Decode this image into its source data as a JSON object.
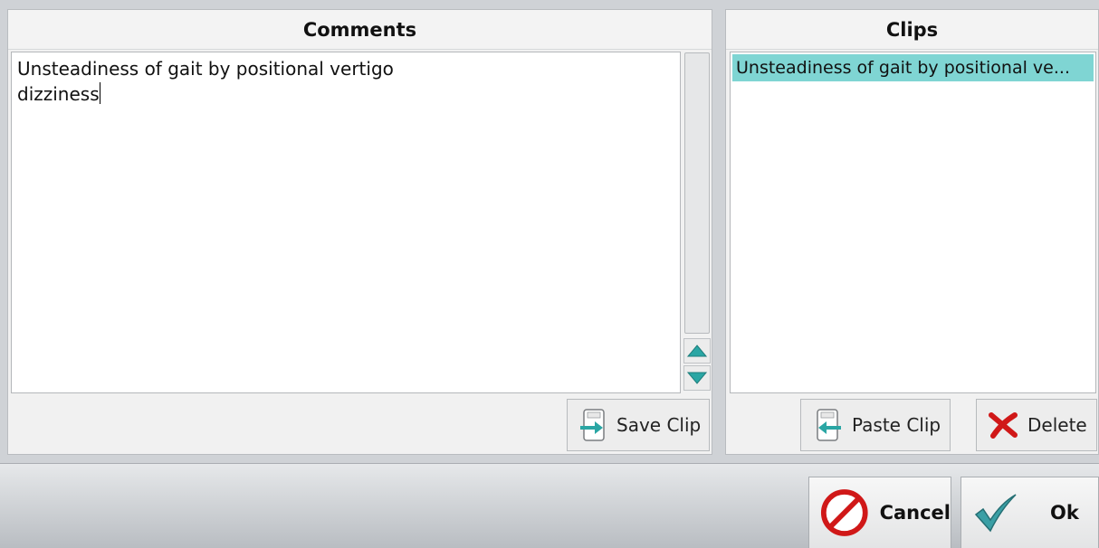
{
  "comments": {
    "title": "Comments",
    "lines": [
      "Unsteadiness of gait by positional vertigo",
      "dizziness"
    ],
    "save_clip_label": "Save Clip"
  },
  "clips": {
    "title": "Clips",
    "items": [
      "Unsteadiness of gait by positional ve..."
    ],
    "paste_clip_label": "Paste Clip",
    "delete_label": "Delete"
  },
  "footer": {
    "cancel_label": "Cancel",
    "ok_label": "Ok"
  },
  "colors": {
    "selection": "#7fd5d3",
    "arrow_teal": "#2aa6a4",
    "cancel_red": "#d01818",
    "check_teal": "#3a9fa5"
  },
  "icons": {
    "save_clip": "clip-save-icon",
    "paste_clip": "clip-paste-icon",
    "delete": "red-x-icon",
    "cancel": "no-entry-icon",
    "ok": "checkmark-icon",
    "scroll_up": "triangle-up-icon",
    "scroll_down": "triangle-down-icon"
  }
}
